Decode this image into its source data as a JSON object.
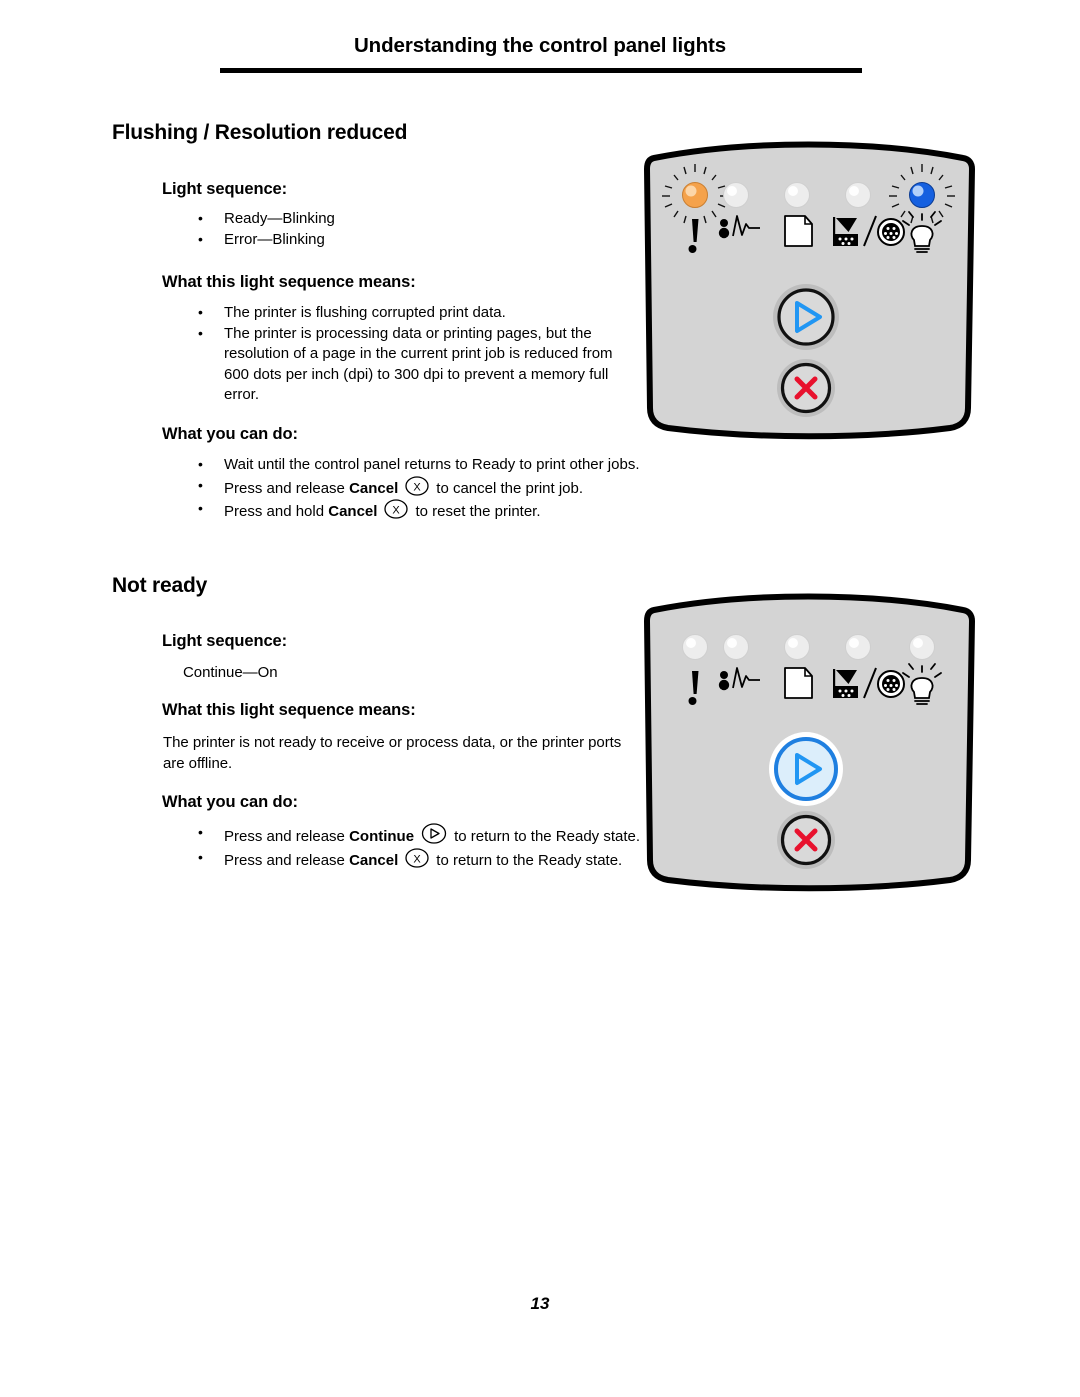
{
  "document": {
    "running_header": "Understanding the control panel lights",
    "page_number": "13"
  },
  "sections": [
    {
      "title": "Flushing / Resolution reduced",
      "light_sequence_heading": "Light sequence:",
      "light_sequence_items": [
        "Ready—Blinking",
        "Error—Blinking"
      ],
      "means_heading": "What this light sequence means:",
      "means_items": [
        "The printer is flushing corrupted print data.",
        "The printer is processing data or printing pages, but the resolution of a page in the current print job is reduced from 600 dots per inch (dpi) to 300 dpi to prevent a memory full error."
      ],
      "actions_heading": "What you can do:",
      "actions": [
        {
          "pre": "Wait until the control panel returns to Ready to print other jobs.",
          "bold": "",
          "icon": "",
          "post": ""
        },
        {
          "pre": "Press and release ",
          "bold": "Cancel",
          "icon": "cancel-x-icon",
          "post": "to cancel the print job."
        },
        {
          "pre": "Press and hold ",
          "bold": "Cancel",
          "icon": "cancel-x-icon",
          "post": "to reset the printer."
        }
      ],
      "panel": {
        "lights": [
          {
            "name": "error-light",
            "icon": "exclamation-icon",
            "state": "blinking",
            "color": "#F5A24B"
          },
          {
            "name": "paper-jam-light",
            "icon": "paper-jam-icon",
            "state": "off",
            "color": "#EDEDED"
          },
          {
            "name": "load-paper-light",
            "icon": "paper-icon",
            "state": "off",
            "color": "#EDEDED"
          },
          {
            "name": "toner-light",
            "icon": "toner-icon",
            "state": "off",
            "color": "#EDEDED"
          },
          {
            "name": "ready-light",
            "icon": "lightbulb-icon",
            "state": "blinking",
            "color": "#1560E0"
          }
        ],
        "buttons": [
          {
            "name": "continue-button",
            "icon": "play-triangle-icon",
            "state": "off",
            "color": "#2196F3"
          },
          {
            "name": "cancel-button",
            "icon": "x-mark-icon",
            "state": "off",
            "color": "#E8112D"
          }
        ]
      }
    },
    {
      "title": "Not ready",
      "light_sequence_heading": "Light sequence:",
      "light_sequence_items": [
        "Continue—On"
      ],
      "means_heading": "What this light sequence means:",
      "means_paragraph": "The printer is not ready to receive or process data, or the printer ports are offline.",
      "actions_heading": "What you can do:",
      "actions": [
        {
          "pre": "Press and release ",
          "bold": "Continue",
          "icon": "continue-play-icon",
          "post": "to return to the Ready state."
        },
        {
          "pre": "Press and release ",
          "bold": "Cancel",
          "icon": "cancel-x-icon",
          "post": "to return to the Ready state."
        }
      ],
      "panel": {
        "lights": [
          {
            "name": "error-light",
            "icon": "exclamation-icon",
            "state": "off",
            "color": "#EDEDED"
          },
          {
            "name": "paper-jam-light",
            "icon": "paper-jam-icon",
            "state": "off",
            "color": "#EDEDED"
          },
          {
            "name": "load-paper-light",
            "icon": "paper-icon",
            "state": "off",
            "color": "#EDEDED"
          },
          {
            "name": "toner-light",
            "icon": "toner-icon",
            "state": "off",
            "color": "#EDEDED"
          },
          {
            "name": "ready-light",
            "icon": "lightbulb-icon",
            "state": "off",
            "color": "#EDEDED"
          }
        ],
        "buttons": [
          {
            "name": "continue-button",
            "icon": "play-triangle-icon",
            "state": "on",
            "color": "#2196F3"
          },
          {
            "name": "cancel-button",
            "icon": "x-mark-icon",
            "state": "off",
            "color": "#E8112D"
          }
        ]
      }
    }
  ],
  "colors": {
    "panel_fill": "#D4D4D4",
    "panel_outline": "#000000",
    "light_off": "#EDEDED",
    "light_error": "#F5A24B",
    "light_ready": "#1560E0",
    "button_ring": "#1F1F1F",
    "button_ring_lit": "#1F7FE0",
    "continue_blue": "#2196F3",
    "cancel_red": "#E8112D"
  }
}
